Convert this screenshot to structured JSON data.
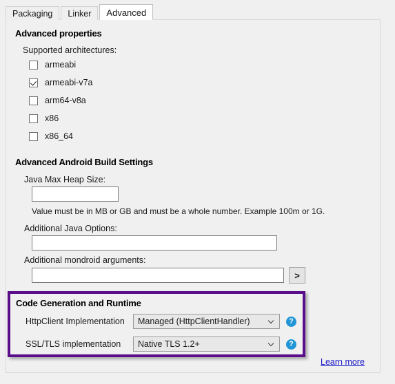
{
  "tabs": [
    {
      "label": "Packaging",
      "selected": false
    },
    {
      "label": "Linker",
      "selected": false
    },
    {
      "label": "Advanced",
      "selected": true
    }
  ],
  "advanced_properties": {
    "title": "Advanced properties",
    "supported_architectures_label": "Supported architectures:",
    "architectures": [
      {
        "label": "armeabi",
        "checked": false
      },
      {
        "label": "armeabi-v7a",
        "checked": true
      },
      {
        "label": "arm64-v8a",
        "checked": false
      },
      {
        "label": "x86",
        "checked": false
      },
      {
        "label": "x86_64",
        "checked": false
      }
    ]
  },
  "build_settings": {
    "title": "Advanced Android Build Settings",
    "java_max_heap_size": {
      "label": "Java Max Heap Size:",
      "value": "",
      "placeholder": "",
      "hint": "Value must be in MB or GB and must be a whole number. Example 100m or 1G."
    },
    "additional_java_options": {
      "label": "Additional Java Options:",
      "value": "",
      "placeholder": ""
    },
    "additional_mondroid_arguments": {
      "label": "Additional mondroid arguments:",
      "value": "",
      "placeholder": "",
      "browse_button_label": ">"
    }
  },
  "code_generation": {
    "title": "Code Generation and Runtime",
    "highlight_color": "#5b0e8b",
    "httpclient": {
      "label": "HttpClient Implementation",
      "value": "Managed (HttpClientHandler)",
      "help_glyph": "?"
    },
    "ssltls": {
      "label": "SSL/TLS implementation",
      "value": "Native TLS 1.2+",
      "help_glyph": "?"
    }
  },
  "footer": {
    "learn_more_label": "Learn more"
  }
}
